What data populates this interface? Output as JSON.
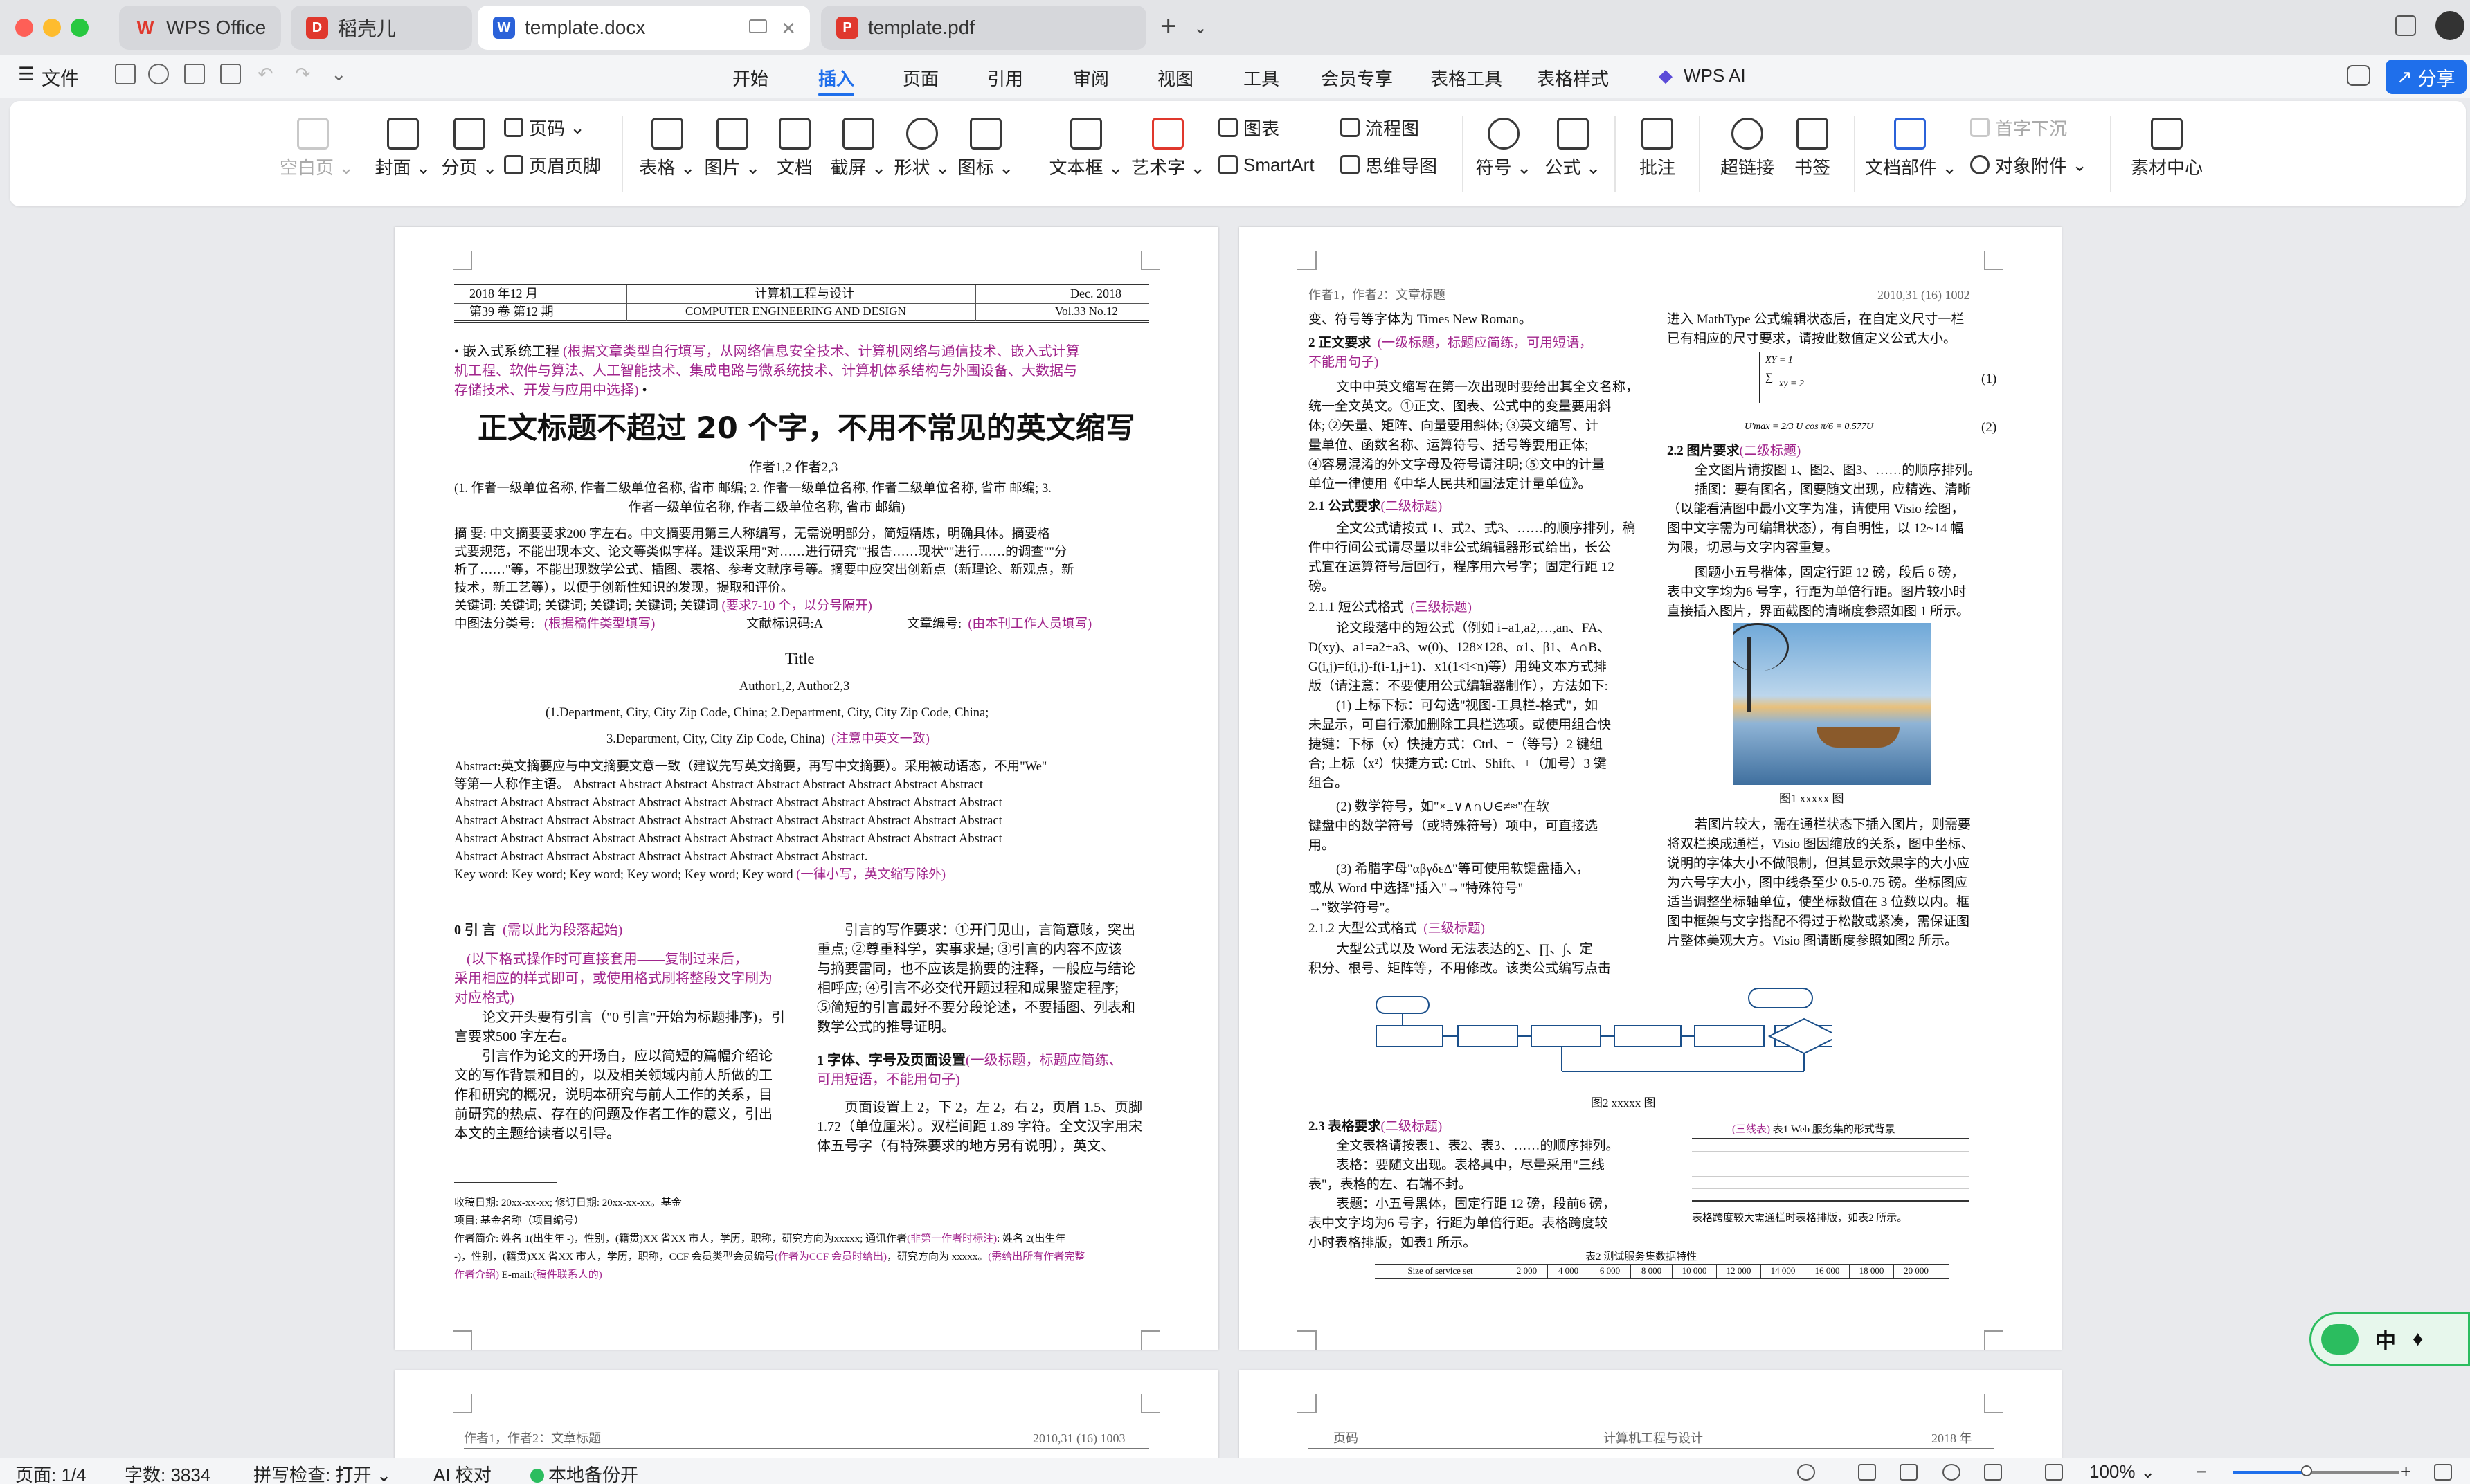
{
  "tabs": [
    {
      "label": "WPS Office",
      "icon": "wps-logo-icon",
      "state": "inactive"
    },
    {
      "label": "稻壳儿",
      "icon": "docer-logo-icon",
      "state": "inactive"
    },
    {
      "label": "template.docx",
      "icon": "word-doc-icon",
      "state": "active"
    },
    {
      "label": "template.pdf",
      "icon": "pdf-doc-icon",
      "state": "inactive"
    }
  ],
  "menubar": {
    "file_label": "文件",
    "tabs": [
      "开始",
      "插入",
      "页面",
      "引用",
      "审阅",
      "视图",
      "工具",
      "会员专享",
      "表格工具",
      "表格样式",
      "WPS AI"
    ],
    "active_tab": "插入",
    "share_label": "分享"
  },
  "ribbon": {
    "blank_page": "空白页",
    "cover": "封面",
    "section_break": "分页",
    "page_number": "页码",
    "header_footer": "页眉页脚",
    "table": "表格",
    "picture": "图片",
    "document": "文档",
    "screenshot": "截屏",
    "shape": "形状",
    "icon": "图标",
    "textbox": "文本框",
    "wordart": "艺术字",
    "chart": "图表",
    "smartart": "SmartArt",
    "flowchart": "流程图",
    "mindmap": "思维导图",
    "symbol": "符号",
    "formula": "公式",
    "comment": "批注",
    "hyperlink": "超链接",
    "bookmark": "书签",
    "doc_parts": "文档部件",
    "drop_cap": "首字下沉",
    "object_attach": "对象附件",
    "material_center": "素材中心"
  },
  "page1": {
    "header_date": "2018 年12 月",
    "header_journal_cn": "计算机工程与设计",
    "header_month": "Dec. 2018",
    "header_vol_cn": "第39 卷  第12 期",
    "header_journal_en": "COMPUTER ENGINEERING AND DESIGN",
    "header_vol_en": "Vol.33   No.12",
    "category_prefix": "• 嵌入式系统工程",
    "category_note_1": "(根据文章类型自行填写，从网络信息安全技术、计算机网络与通信技术、嵌入式计算",
    "category_note_2": "机工程、软件与算法、人工智能技术、集成电路与微系统技术、计算机体系结构与外围设备、大数据与",
    "category_note_3": "存储技术、开发与应用中选择)",
    "category_suffix": " •",
    "title_cn": "正文标题不超过 20 个字，不用不常见的英文缩写",
    "authors_cn": "作者1,2    作者2,3",
    "affil_cn_1": "(1. 作者一级单位名称, 作者二级单位名称, 省市 邮编; 2. 作者一级单位名称, 作者二级单位名称, 省市 邮编; 3.",
    "affil_cn_2": "作者一级单位名称, 作者二级单位名称, 省市 邮编)",
    "abstract_cn_1": "摘    要: 中文摘要要求200 字左右。中文摘要用第三人称编写，无需说明部分，简短精炼，明确具体。摘要格",
    "abstract_cn_2": "式要规范，不能出现本文、论文等类似字样。建议采用\"对……进行研究\"\"报告……现状\"\"进行……的调查\"\"分",
    "abstract_cn_3": "析了……\"等，不能出现数学公式、插图、表格、参考文献序号等。摘要中应突出创新点（新理论、新观点，新",
    "abstract_cn_4": "技术，新工艺等），以便于创新性知识的发现，提取和评价。",
    "keywords_cn": "关键词: 关键词; 关键词; 关键词; 关键词; 关键词",
    "keywords_cn_note": "(要求7-10 个，以分号隔开)",
    "clc_label": "中图法分类号:",
    "clc_note": "(根据稿件类型填写)",
    "doc_code": "文献标识码:A",
    "article_no": "文章编号:",
    "article_no_note": "(由本刊工作人员填写)",
    "title_en": "Title",
    "authors_en": "Author1,2,     Author2,3",
    "affil_en_1": "(1.Department, City, City Zip Code, China;     2.Department, City, City Zip Code, China;",
    "affil_en_2": "3.Department, City, City Zip Code, China)",
    "affil_en_note": "(注意中英文一致)",
    "abstract_en_1": "Abstract:英文摘要应与中文摘要文意一致（建议先写英文摘要，再写中文摘要）。采用被动语态，不用\"We\"",
    "abstract_en_2": "等第一人称作主语。 Abstract Abstract Abstract Abstract Abstract Abstract Abstract Abstract Abstract",
    "abstract_en_3": "Abstract Abstract Abstract Abstract Abstract Abstract Abstract Abstract Abstract Abstract Abstract Abstract",
    "abstract_en_4": "Abstract Abstract Abstract Abstract Abstract Abstract Abstract Abstract Abstract Abstract Abstract Abstract",
    "abstract_en_5": "Abstract Abstract Abstract Abstract Abstract Abstract Abstract Abstract Abstract Abstract Abstract Abstract",
    "abstract_en_6": "Abstract Abstract Abstract Abstract Abstract Abstract Abstract Abstract Abstract.",
    "keywords_en": "Key word: Key word; Key word; Key word; Key word; Key word",
    "keywords_en_note": "(一律小写，英文缩写除外)",
    "sec0_title": "0    引    言",
    "sec0_note": "(需以此为段落起始)",
    "note_red_1": "(以下格式操作时可直接套用——复制过来后，",
    "note_red_2": "采用相应的样式即可，或使用格式刷将整段文字刷为",
    "note_red_3": "对应格式)",
    "left_col_1": "论文开头要有引言（\"0 引言\"开始为标题排序)，引",
    "left_col_2": "言要求500 字左右。",
    "left_col_3": "引言作为论文的开场白，应以简短的篇幅介绍论",
    "left_col_4": "文的写作背景和目的，以及相关领域内前人所做的工",
    "left_col_5": "作和研究的概况，说明本研究与前人工作的关系，目",
    "left_col_6": "前研究的热点、存在的问题及作者工作的意义，引出",
    "left_col_7": "本文的主题给读者以引导。",
    "right_col_1": "引言的写作要求：①开门见山，言简意赅，突出",
    "right_col_2": "重点; ②尊重科学，实事求是; ③引言的内容不应该",
    "right_col_3": "与摘要雷同，也不应该是摘要的注释，一般应与结论",
    "right_col_4": "相呼应; ④引言不必交代开题过程和成果鉴定程序;",
    "right_col_5": "⑤简短的引言最好不要分段论述，不要插图、列表和",
    "right_col_6": "数学公式的推导证明。",
    "sec1_title": "1    字体、字号及页面设置",
    "sec1_note": "(一级标题，标题应简练、",
    "sec1_note2": "可用短语，不能用句子)",
    "right_col_7": "页面设置上 2，下 2，左 2，右 2，页眉 1.5、页脚",
    "right_col_8": "1.72（单位厘米）。双栏间距 1.89 字符。全文汉字用宋",
    "right_col_9": "体五号字（有特殊要求的地方另有说明），英文、",
    "fn_1": "收稿日期:    20xx-xx-xx; 修订日期:    20xx-xx-xx。基金",
    "fn_2": "项目: 基金名称（项目编号）",
    "fn_3": "作者简介: 姓名 1(出生年 -)，性别，(籍贯)XX 省XX 市人，学历，职称，研究方向为xxxxx; 通讯作者",
    "fn_3_note": "(非第一作者时标注)",
    "fn_3b": ": 姓名 2(出生年",
    "fn_4": " -)，性别，(籍贯)XX 省XX 市人，学历，职称，CCF 会员类型会员编号",
    "fn_4_note": "(作者为CCF 会员时给出)",
    "fn_4b": "，研究方向为 xxxxx。",
    "fn_4_note2": "(需给出所有作者完整",
    "fn_5_note": "作者介绍)",
    "fn_5": "  E-mail:",
    "fn_5_note2": "(稿件联系人的)"
  },
  "page2": {
    "header_left": "作者1，作者2：文章标题",
    "header_right": "2010,31 (16)    1002",
    "l1": "变、符号等字体为 Times New Roman。",
    "l2_title": "2    正文要求",
    "l2_note": "(一级标题，标题应简练，可用短语，",
    "l2_note2": "不能用句子)",
    "l3": "文中中英文缩写在第一次出现时要给出其全文名称，",
    "l4": "统一全文英文。①正文、图表、公式中的变量要用斜",
    "l5": "体; ②矢量、矩阵、向量要用斜体; ③英文缩写、计",
    "l6": "量单位、函数名称、运算符号、括号等要用正体;",
    "l7": "④容易混淆的外文字母及符号请注明; ⑤文中的计量",
    "l8": "单位一律使用《中华人民共和国法定计量单位》。",
    "s21_title": "2.1    公式要求",
    "s21_note": "(二级标题)",
    "l9": "全文公式请按式 1、式2、式3、……的顺序排列，稿",
    "l10": "件中行间公式请尽量以非公式编辑器形式给出，长公",
    "l11": "式宜在运算符号后回行，程序用六号字；固定行距 12",
    "l12": "磅。",
    "s211_title": "2.1.1         短公式格式",
    "s211_note": "(三级标题)",
    "l13": "论文段落中的短公式（例如 i=a1,a2,…,an、FA、",
    "l14": "D(xy)、a1=a2+a3、w(0)、128×128、α1、β1、A∩B、",
    "l15": "G(i,j)=f(i,j)-f(i-1,j+1)、x1(1<i<n)等）用纯文本方式排",
    "l16": "版（请注意：不要使用公式编辑器制作），方法如下:",
    "l17": "(1)     上标下标：可勾选\"视图-工具栏-格式\"，如",
    "l18": "未显示，可自行添加删除工具栏选项。或使用组合快",
    "l19": "捷键：下标（x）快捷方式：Ctrl、=（等号）2 键组",
    "l20": "合; 上标（x²）快捷方式: Ctrl、Shift、+（加号）3 键",
    "l21": "组合。",
    "l22": "(2)     数学符号，如\"×±∨∧∩∪∈≠≈\"在软",
    "l23": "键盘中的数学符号（或特殊符号）项中，可直接选",
    "l24": "用。",
    "l25": "(3)     希腊字母\"αβγδεΔ\"等可使用软键盘插入，",
    "l26": "或从 Word 中选择\"插入\"→\"特殊符号\"",
    "l27": "→\"数学符号\"。",
    "s212_title": "2.1.2         大型公式格式",
    "s212_note": "(三级标题)",
    "l28": "大型公式以及 Word 无法表达的∑、∏、∫、定",
    "l29": "积分、根号、矩阵等，不用修改。该类公式编写点击",
    "r1": "进入 MathType 公式编辑状态后，在自定义尺寸一栏",
    "r2": "已有相应的尺寸要求，请按此数值定义公式大小。",
    "eq1_num": "(1)",
    "eq2_num": "(2)",
    "s22_title": "2.2    图片要求",
    "s22_note": "(二级标题)",
    "r3": "全文图片请按图 1、图2、图3、……的顺序排列。",
    "r4": "插图：要有图名，图要随文出现，应精选、清晰",
    "r5": "（以能看清图中最小文字为准，请使用 Visio 绘图，",
    "r6": "图中文字需为可编辑状态），有自明性，以 12~14 幅",
    "r7": "为限，切忌与文字内容重复。",
    "r8": "图题小五号楷体，固定行距 12 磅，段后 6 磅，",
    "r9": "表中文字均为6 号字，行距为单倍行距。图片较小时",
    "r10": "直接插入图片，界面截图的清晰度参照如图 1 所示。",
    "fig1_caption": "图1    xxxxx 图",
    "r11": "若图片较大，需在通栏状态下插入图片，则需要",
    "r12": "将双栏换成通栏，Visio 图因缩放的关系，图中坐标、",
    "r13": "说明的字体大小不做限制，但其显示效果字的大小应",
    "r14": "为六号字大小，图中线条至少 0.5-0.75 磅。坐标图应",
    "r15": "适当调整坐标轴单位，使坐标数值在 3 位数以内。框",
    "r16": "图中框架与文字搭配不得过于松散或紧凑，需保证图",
    "r17": "片整体美观大方。Visio 图请断度参照如图2 所示。",
    "fig2_caption": "图2    xxxxx 图",
    "s23_title": "2.3    表格要求",
    "s23_note": "(二级标题)",
    "t1": "全文表格请按表1、表2、表3、……的顺序排列。",
    "t2": "表格：要随文出现。表格具中，尽量采用\"三线",
    "t3": "表\"，表格的左、右端不封。",
    "t4": "表题：小五号黑体，固定行距 12 磅，段前6 磅，",
    "t5": "表中文字均为6 号字，行距为单倍行距。表格跨度较",
    "t6": "小时表格排版，如表1 所示。",
    "tbl1_caption_note": "(三线表)",
    "tbl1_caption": "表1    Web 服务集的形式背景",
    "tbl1_note": "表格跨度较大需通栏时表格排版，如表2 所示。",
    "tbl2_caption": "表2    测试服务集数据特性",
    "tbl2_header": [
      "Size of service set",
      "2 000",
      "4 000",
      "6 000",
      "8 000",
      "10 000",
      "12 000",
      "14 000",
      "16 000",
      "18 000",
      "20 000"
    ]
  },
  "page3": {
    "header_left": "作者1，作者2：文章标题",
    "header_right": "2010,31 (16)    1003"
  },
  "page4": {
    "header_left": "页码",
    "header_center": "计算机工程与设计",
    "header_right": "2018 年"
  },
  "statusbar": {
    "page": "页面: 1/4",
    "words": "字数: 3834",
    "spell": "拼写检查: 打开",
    "ai_check": "AI 校对",
    "backup": "本地备份开",
    "zoom": "100%"
  },
  "ime": {
    "label": "中"
  },
  "colors": {
    "accent": "#1f6feb",
    "purple_note": "#a1258c",
    "share": "#1f6feb"
  }
}
